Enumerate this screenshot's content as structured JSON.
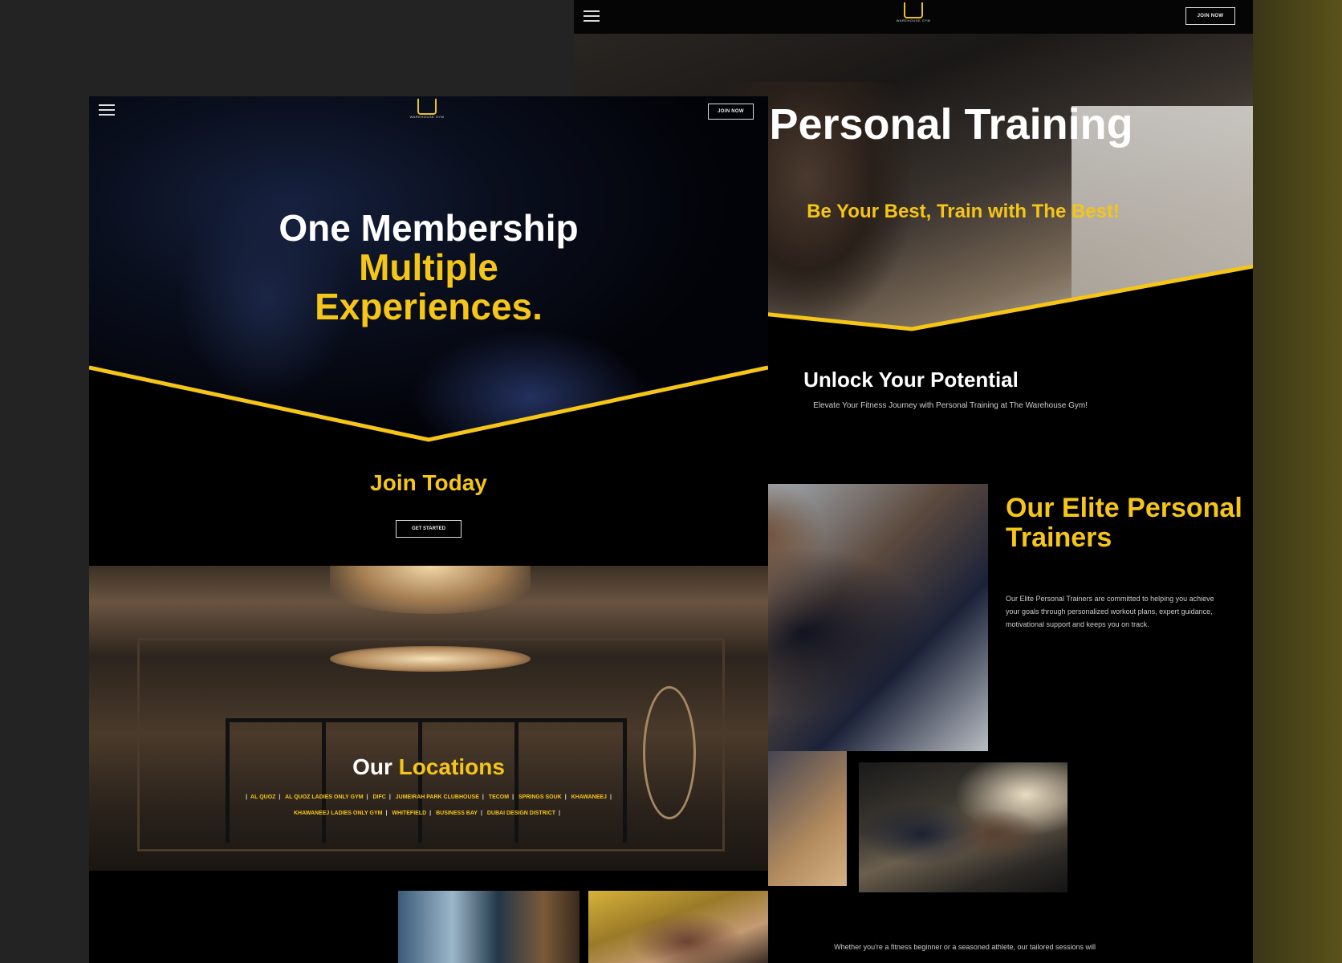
{
  "back_page": {
    "nav": {
      "join_label": "JOIN NOW",
      "logo_text": "WAREHOUSE GYM"
    },
    "hero_title": "Personal Training",
    "hero_tagline": "Be Your Best, Train with The Best!",
    "unlock_title": "Unlock Your Potential",
    "unlock_subtitle": "Elevate Your Fitness Journey with Personal Training at The Warehouse Gym!",
    "elite_title": "Our Elite Personal Trainers",
    "elite_body": "Our Elite Personal Trainers are committed to helping you achieve your goals through personalized workout plans, expert guidance, motivational support and keeps you on track.",
    "bottom_text": "Whether you're a fitness beginner or a seasoned athlete, our tailored sessions will"
  },
  "front_page": {
    "nav": {
      "join_label": "JOIN NOW",
      "logo_text": "WAREHOUSE GYM"
    },
    "hero_line1": "One Membership",
    "hero_line2": "Multiple",
    "hero_line3": "Experiences.",
    "join_today": "Join Today",
    "get_started": "GET STARTED",
    "locations_title_a": "Our",
    "locations_title_b": "Locations",
    "locations": [
      "AL QUOZ",
      "AL QUOZ LADIES ONLY GYM",
      "DIFC",
      "JUMEIRAH PARK CLUBHOUSE",
      "TECOM",
      "SPRINGS SOUK",
      "KHAWANEEJ",
      "KHAWANEEJ LADIES ONLY GYM",
      "WHITEFIELD",
      "BUSINESS BAY",
      "DUBAI DESIGN DISTRICT"
    ]
  },
  "colors": {
    "accent": "#f5c518",
    "background": "#000000"
  },
  "icons": {
    "menu": "hamburger-menu-icon",
    "logo": "warehouse-gym-logo"
  }
}
